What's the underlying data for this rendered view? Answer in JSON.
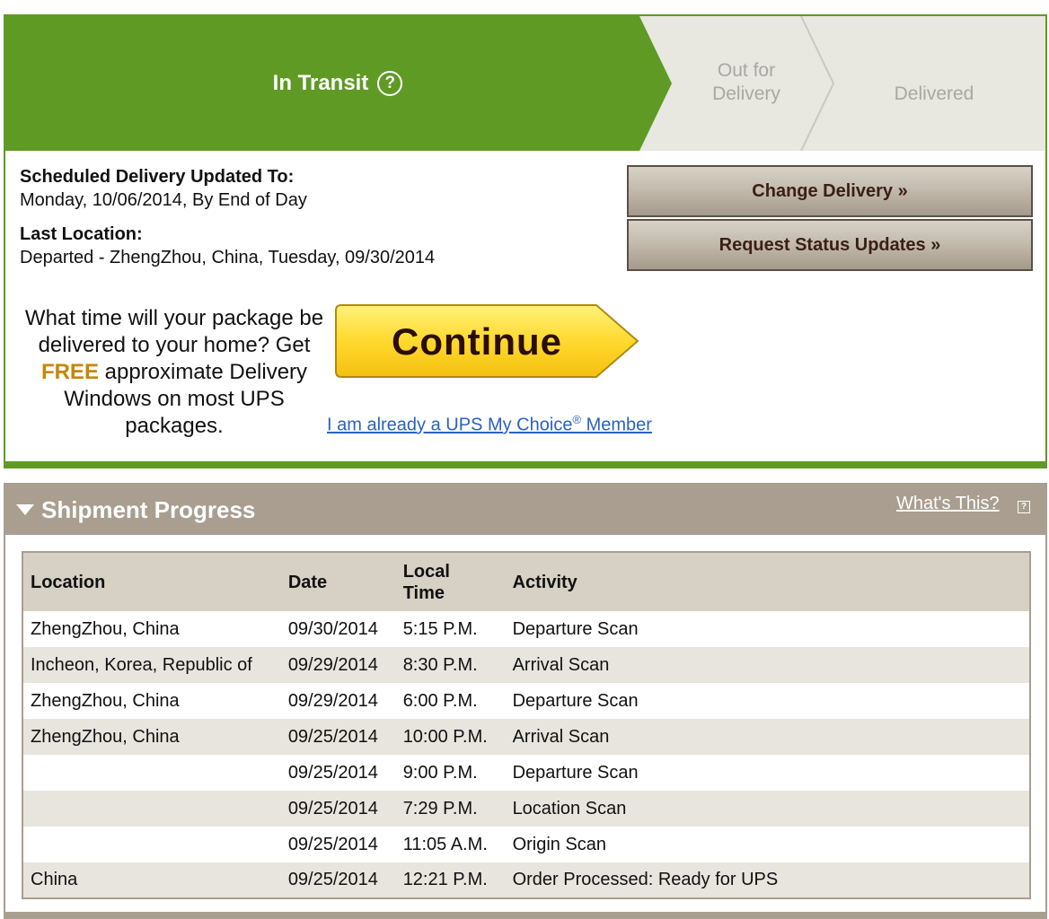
{
  "progress": {
    "stages": {
      "in_transit": "In Transit",
      "out_for_delivery_line1": "Out for",
      "out_for_delivery_line2": "Delivery",
      "delivered": "Delivered"
    },
    "help_icon_glyph": "?",
    "active_color": "#5e9a24",
    "inactive_color": "#e8e7e0"
  },
  "delivery": {
    "scheduled_label": "Scheduled Delivery Updated To:",
    "scheduled_value": "Monday, 10/06/2014, By End of Day",
    "last_location_label": "Last Location:",
    "last_location_value": "Departed - ZhengZhou, China, Tuesday, 09/30/2014"
  },
  "actions": {
    "change_delivery": "Change Delivery »",
    "request_updates": "Request Status Updates »"
  },
  "promo": {
    "text_before": "What time will your package be delivered to your home? Get ",
    "free": "FREE",
    "text_after": " approximate Delivery Windows on most UPS packages.",
    "continue_label": "Continue",
    "mychoice_link_before": "I am already a UPS My Choice",
    "mychoice_reg": "®",
    "mychoice_link_after": " Member"
  },
  "shipment": {
    "title": "Shipment Progress",
    "whats_this": "What's This?",
    "whats_this_glyph": "?",
    "columns": {
      "location": "Location",
      "date": "Date",
      "local_time_line1": "Local",
      "local_time_line2": "Time",
      "activity": "Activity"
    },
    "rows": [
      {
        "location": "ZhengZhou, China",
        "date": "09/30/2014",
        "time": "5:15 P.M.",
        "activity": "Departure Scan"
      },
      {
        "location": "Incheon, Korea, Republic of",
        "date": "09/29/2014",
        "time": "8:30 P.M.",
        "activity": "Arrival Scan"
      },
      {
        "location": "ZhengZhou, China",
        "date": "09/29/2014",
        "time": "6:00 P.M.",
        "activity": "Departure Scan"
      },
      {
        "location": "ZhengZhou, China",
        "date": "09/25/2014",
        "time": "10:00 P.M.",
        "activity": "Arrival Scan"
      },
      {
        "location": "",
        "date": "09/25/2014",
        "time": "9:00 P.M.",
        "activity": "Departure Scan"
      },
      {
        "location": "",
        "date": "09/25/2014",
        "time": "7:29 P.M.",
        "activity": "Location Scan"
      },
      {
        "location": "",
        "date": "09/25/2014",
        "time": "11:05 A.M.",
        "activity": "Origin Scan"
      },
      {
        "location": "China",
        "date": "09/25/2014",
        "time": "12:21 P.M.",
        "activity": "Order Processed: Ready for UPS"
      }
    ]
  }
}
